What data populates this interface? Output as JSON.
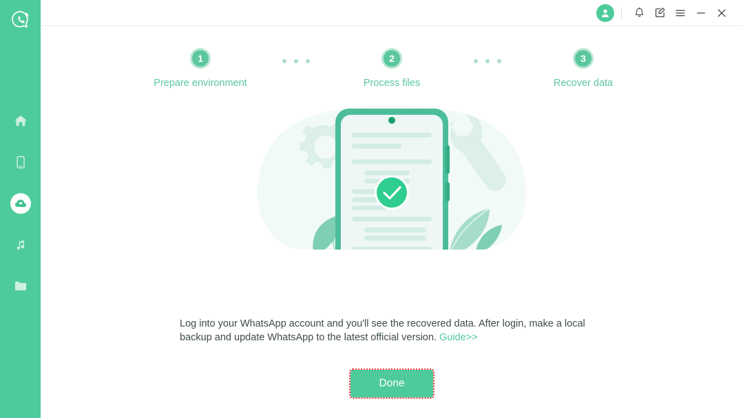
{
  "app": {
    "brand_color": "#4ecb9a",
    "logo_icon": "whatsapp-recovery-logo-icon"
  },
  "sidebar": {
    "items": [
      {
        "icon": "home-icon",
        "name": "home",
        "active": false
      },
      {
        "icon": "device-icon",
        "name": "device",
        "active": false
      },
      {
        "icon": "cloud-icon",
        "name": "recover",
        "active": true
      },
      {
        "icon": "music-icon",
        "name": "media",
        "active": false
      },
      {
        "icon": "folder-icon",
        "name": "files",
        "active": false
      }
    ]
  },
  "titlebar": {
    "avatar_icon": "user-avatar-icon",
    "icons": [
      {
        "icon": "bell-icon",
        "name": "notifications"
      },
      {
        "icon": "feedback-icon",
        "name": "feedback"
      },
      {
        "icon": "hamburger-icon",
        "name": "menu"
      },
      {
        "icon": "minimize-icon",
        "name": "minimize"
      },
      {
        "icon": "close-icon",
        "name": "close"
      }
    ]
  },
  "stepper": {
    "steps": [
      {
        "number": "1",
        "label": "Prepare environment"
      },
      {
        "number": "2",
        "label": "Process files"
      },
      {
        "number": "3",
        "label": "Recover data"
      }
    ],
    "active_color": "#5bc79c",
    "dot_color": "#a9dfc7"
  },
  "illustration": {
    "name": "phone-recovery-success-illustration",
    "elements": [
      "gear-icon",
      "wrench-icon",
      "phone-icon",
      "checkmark-icon",
      "leaf-icon"
    ]
  },
  "caption": {
    "line1": "Log into your WhatsApp account and you'll see the recovered data. After login, make a local backup",
    "line2": "and update WhatsApp to the latest official version. ",
    "link": "Guide>>"
  },
  "actions": {
    "done_label": "Done"
  }
}
